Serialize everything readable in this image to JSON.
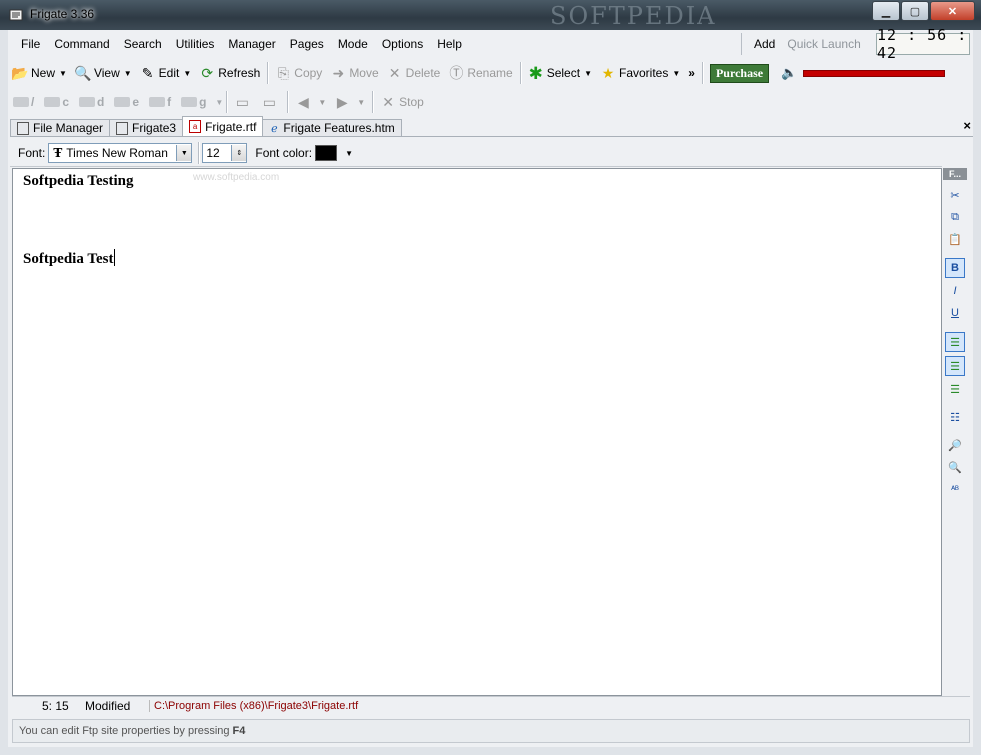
{
  "window": {
    "title": "Frigate 3.36",
    "watermark": "SOFTPEDIA"
  },
  "menu": [
    "File",
    "Command",
    "Search",
    "Utilities",
    "Manager",
    "Pages",
    "Mode",
    "Options",
    "Help"
  ],
  "quick": {
    "add": "Add",
    "launch": "Quick Launch"
  },
  "clock": "12 : 56 : 42",
  "toolbar1": {
    "new": "New",
    "view": "View",
    "edit": "Edit",
    "refresh": "Refresh",
    "copy": "Copy",
    "move": "Move",
    "delete": "Delete",
    "rename": "Rename",
    "select": "Select",
    "favorites": "Favorites",
    "more": "»",
    "purchase": "Purchase"
  },
  "toolbar2": {
    "drives": [
      "/",
      "c",
      "d",
      "e",
      "f",
      "g"
    ],
    "stop": "Stop"
  },
  "tabs": [
    {
      "label": "File Manager",
      "icon": "panel-icon"
    },
    {
      "label": "Frigate3",
      "icon": "panel-icon"
    },
    {
      "label": "Frigate.rtf",
      "icon": "rtf-icon"
    },
    {
      "label": "Frigate Features.htm",
      "icon": "web-icon"
    }
  ],
  "tabs_close": "×",
  "fontbar": {
    "font_label": "Font:",
    "font_value": "Times New Roman",
    "size": "12",
    "color_label": "Font color:"
  },
  "editor": {
    "line1": "Softpedia Testing",
    "line2": "Softpedia Test",
    "watermark": "www.softpedia.com"
  },
  "side_panel": {
    "title": "F..."
  },
  "status": {
    "position": "5:  15",
    "state": "Modified",
    "path": "C:\\Program Files (x86)\\Frigate3\\Frigate.rtf"
  },
  "hint": {
    "text": "You can edit Ftp site properties by pressing",
    "key": "F4"
  },
  "colors": {
    "purchase": "#3e7a38",
    "volume": "#c40000",
    "path": "#8b0000"
  }
}
